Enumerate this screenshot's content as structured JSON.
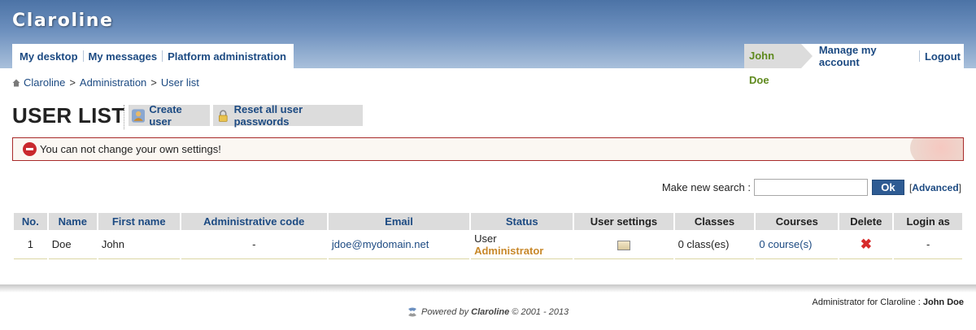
{
  "app": {
    "title": "Claroline"
  },
  "nav": {
    "left": [
      "My desktop",
      "My messages",
      "Platform administration"
    ],
    "user_name": "John Doe",
    "right": [
      "Manage my account",
      "Logout"
    ]
  },
  "breadcrumb": [
    "Claroline",
    "Administration",
    "User list"
  ],
  "page": {
    "title": "USER LIST",
    "create_user": "Create user",
    "reset_passwords": "Reset all user passwords"
  },
  "error": {
    "message": "You can not change your own settings!"
  },
  "search": {
    "label": "Make new search :",
    "value": "",
    "placeholder": "",
    "ok": "Ok",
    "advanced": "Advanced"
  },
  "table": {
    "headers": [
      "No.",
      "Name",
      "First name",
      "Administrative code",
      "Email",
      "Status",
      "User settings",
      "Classes",
      "Courses",
      "Delete",
      "Login as"
    ],
    "rows": [
      {
        "no": "1",
        "name": "Doe",
        "first_name": "John",
        "admin_code": "-",
        "email": "jdoe@mydomain.net",
        "status_user": "User",
        "status_admin": "Administrator",
        "classes": "0 class(es)",
        "courses": "0 course(s)",
        "login_as": "-"
      }
    ]
  },
  "footer": {
    "admin_label": "Administrator for Claroline :",
    "admin_name": "John Doe",
    "powered_prefix": "Powered by",
    "powered_brand": "Claroline",
    "powered_suffix": "© 2001 - 2013"
  },
  "colors": {
    "header_top": "#4c73a6",
    "link": "#1c4a82",
    "user_name": "#5f8a1e",
    "admin_status": "#c8882a",
    "error_border": "#a82a2a",
    "ok_button": "#2e5b93"
  },
  "icons": {
    "home": "home-icon",
    "create_user": "user-add-icon",
    "reset_passwords": "lock-icon",
    "error": "error-icon",
    "user_settings": "user-card-icon",
    "delete": "delete-icon",
    "powered": "claroline-logo-icon"
  }
}
